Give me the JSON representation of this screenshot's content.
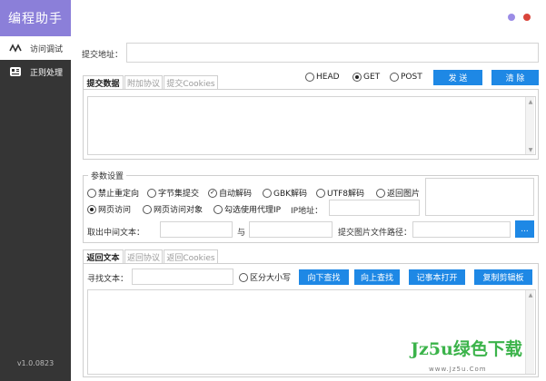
{
  "app": {
    "name": "编程助手",
    "version": "v1.0.0823"
  },
  "colors": {
    "sidebar": "#353535",
    "logo_bg": "#8b7fd9",
    "accent": "#1e88e5",
    "dot_purple": "#9b8ce6",
    "dot_red": "#d9453b"
  },
  "sidebar": {
    "items": [
      {
        "label": "访问调试",
        "icon": "pulse-icon",
        "active": true
      },
      {
        "label": "正则处理",
        "icon": "regex-icon",
        "active": false
      }
    ]
  },
  "request": {
    "url_label": "提交地址：",
    "url_value": "",
    "tabs": [
      "提交数据",
      "附加协议",
      "提交Cookies"
    ],
    "active_tab": 0,
    "methods": [
      "HEAD",
      "GET",
      "POST"
    ],
    "selected_method": "GET",
    "send_label": "发 送",
    "clear_label": "清 除"
  },
  "params": {
    "title": "参数设置",
    "row1": [
      "禁止重定向",
      "字节集提交",
      "自动解码",
      "GBK解码",
      "UTF8解码",
      "返回图片"
    ],
    "row2": [
      "网页访问",
      "网页访问对象",
      "勾选使用代理IP"
    ],
    "ip_label": "IP地址：",
    "middle_label": "取出中间文本：",
    "and_label": "与",
    "image_path_label": "提交图片文件路径：",
    "browse_label": "..."
  },
  "response": {
    "tabs": [
      "返回文本",
      "返回协议",
      "返回Cookies"
    ],
    "active_tab": 0,
    "find_label": "寻找文本：",
    "case_label": "区分大小写",
    "find_down_label": "向下查找",
    "find_up_label": "向上查找",
    "notepad_label": "记事本打开",
    "copy_label": "复制剪辑板"
  },
  "watermark": {
    "text": "Jz5u绿色下载",
    "url": "www.Jz5u.Com"
  }
}
